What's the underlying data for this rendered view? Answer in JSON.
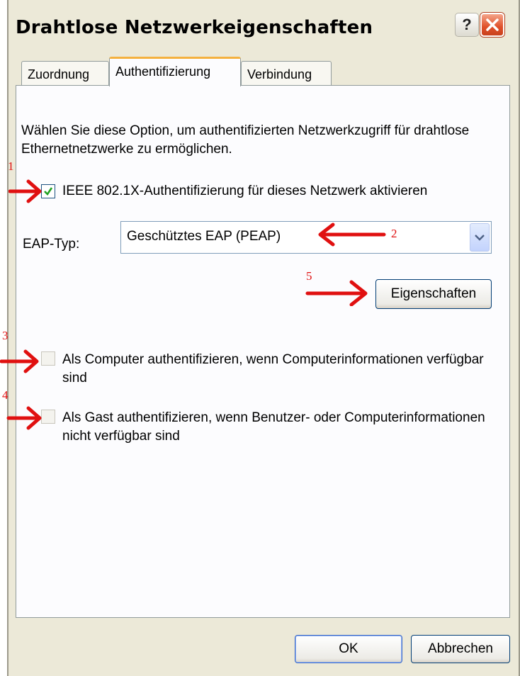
{
  "window": {
    "title": "Drahtlose Netzwerkeigenschaften",
    "help_label": "?"
  },
  "tabs": [
    {
      "label": "Zuordnung",
      "active": false
    },
    {
      "label": "Authentifizierung",
      "active": true
    },
    {
      "label": "Verbindung",
      "active": false
    }
  ],
  "auth": {
    "description": "Wählen Sie diese Option, um authentifizierten Netzwerkzugriff für drahtlose Ethernetnetzwerke zu ermöglichen.",
    "enable_8021x": {
      "label": "IEEE 802.1X-Authentifizierung für dieses Netzwerk aktivieren",
      "checked": true
    },
    "eap_label": "EAP-Typ:",
    "eap_value": "Geschütztes EAP (PEAP)",
    "properties_button": "Eigenschaften",
    "computer_auth": {
      "label": "Als Computer authentifizieren, wenn Computerinformationen verfügbar sind",
      "checked": false
    },
    "guest_auth": {
      "label": "Als Gast authentifizieren, wenn Benutzer- oder Computerinformationen nicht verfügbar sind",
      "checked": false
    }
  },
  "footer": {
    "ok_label": "OK",
    "cancel_label": "Abbrechen"
  },
  "annotations": {
    "n1": "1",
    "n2": "2",
    "n3": "3",
    "n4": "4",
    "n5": "5",
    "arrow_color": "#e01010"
  },
  "colors": {
    "face": "#ece9d8",
    "panel": "#fcfcfe",
    "tab_highlight": "#f4b13f",
    "check_green": "#21a121"
  }
}
